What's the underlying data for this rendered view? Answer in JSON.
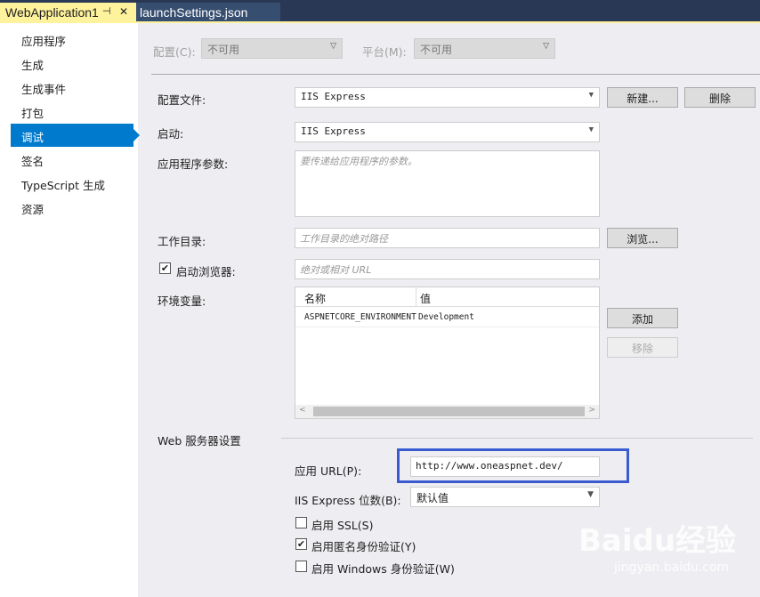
{
  "tabs": [
    {
      "label": "WebApplication1",
      "pin": "⊣",
      "close": "✕"
    },
    {
      "label": "launchSettings.json"
    }
  ],
  "sidebar": {
    "items": [
      {
        "label": "应用程序"
      },
      {
        "label": "生成"
      },
      {
        "label": "生成事件"
      },
      {
        "label": "打包"
      },
      {
        "label": "调试",
        "selected": true
      },
      {
        "label": "签名"
      },
      {
        "label": "TypeScript 生成"
      },
      {
        "label": "资源"
      }
    ]
  },
  "top": {
    "config_label": "配置(C):",
    "config_value": "不可用",
    "platform_label": "平台(M):",
    "platform_value": "不可用"
  },
  "profile": {
    "label": "配置文件:",
    "value": "IIS Express",
    "new": "新建...",
    "delete": "删除"
  },
  "launch": {
    "label": "启动:",
    "value": "IIS Express"
  },
  "args": {
    "label": "应用程序参数:",
    "placeholder": "要传递给应用程序的参数。"
  },
  "workdir": {
    "label": "工作目录:",
    "placeholder": "工作目录的绝对路径",
    "browse": "浏览..."
  },
  "browser": {
    "label": "启动浏览器:",
    "checked": true,
    "placeholder": "绝对或相对 URL"
  },
  "env": {
    "label": "环境变量:",
    "headers": [
      "名称",
      "值"
    ],
    "rows": [
      [
        "ASPNETCORE_ENVIRONMENT",
        "Development"
      ]
    ],
    "add": "添加",
    "remove": "移除"
  },
  "web": {
    "section": "Web 服务器设置",
    "url_label": "应用 URL(P):",
    "url_value": "http://www.oneaspnet.dev/",
    "bits_label": "IIS Express 位数(B):",
    "bits_value": "默认值",
    "ssl": "启用 SSL(S)",
    "anon": "启用匿名身份验证(Y)",
    "windows": "启用 Windows 身份验证(W)"
  },
  "watermark": {
    "brand": "Baidu经验",
    "url": "jingyan.baidu.com"
  }
}
